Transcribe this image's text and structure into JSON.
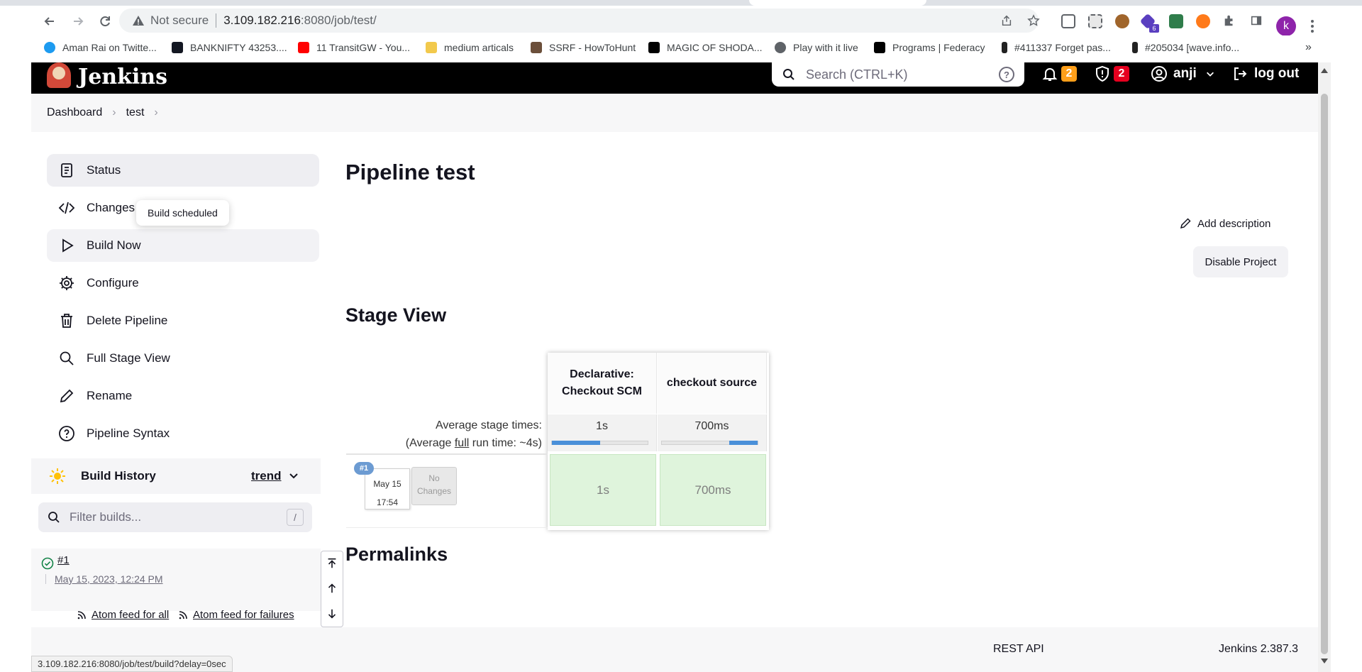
{
  "browser": {
    "security_label": "Not secure",
    "url_host": "3.109.182.216",
    "url_path": ":8080/job/test/",
    "profile_initial": "k",
    "ext_badge": "6",
    "bookmarks": [
      {
        "label": "Aman Rai on Twitte...",
        "color": "#1d9bf0"
      },
      {
        "label": "BANKNIFTY 43253....",
        "color": "#131722"
      },
      {
        "label": "11 TransitGW - You...",
        "color": "#ff0000"
      },
      {
        "label": "medium articals",
        "color": "#f2c94c"
      },
      {
        "label": "SSRF - HowToHunt",
        "color": "#6b4f3a"
      },
      {
        "label": "MAGIC OF SHODA...",
        "color": "#000000"
      },
      {
        "label": "Play with it live",
        "color": "#5f6368"
      },
      {
        "label": "Programs | Federacy",
        "color": "#000000"
      },
      {
        "label": "#411337 Forget pas...",
        "color": "#222222"
      },
      {
        "label": "#205034 [wave.info...",
        "color": "#222222"
      }
    ],
    "status_url": "3.109.182.216:8080/job/test/build?delay=0sec"
  },
  "header": {
    "brand": "Jenkins",
    "search_placeholder": "Search (CTRL+K)",
    "notifications_count": "2",
    "security_count": "2",
    "user": "anji",
    "logout": "log out"
  },
  "breadcrumb": [
    "Dashboard",
    "test"
  ],
  "sidebar": {
    "items": [
      {
        "label": "Status",
        "icon": "document-icon"
      },
      {
        "label": "Changes",
        "icon": "code-icon"
      },
      {
        "label": "Build Now",
        "icon": "play-icon"
      },
      {
        "label": "Configure",
        "icon": "gear-icon"
      },
      {
        "label": "Delete Pipeline",
        "icon": "trash-icon"
      },
      {
        "label": "Full Stage View",
        "icon": "search-icon"
      },
      {
        "label": "Rename",
        "icon": "pencil-icon"
      },
      {
        "label": "Pipeline Syntax",
        "icon": "help-icon"
      }
    ],
    "tooltip": "Build scheduled"
  },
  "build_history": {
    "title": "Build History",
    "trend": "trend",
    "filter_placeholder": "Filter builds...",
    "filter_shortcut": "/",
    "builds": [
      {
        "number": "#1",
        "date": "May 15, 2023, 12:24 PM",
        "status": "success"
      }
    ],
    "atom_all": "Atom feed for all",
    "atom_failures": "Atom feed for failures"
  },
  "main": {
    "title": "Pipeline test",
    "add_description": "Add description",
    "disable_project": "Disable Project",
    "stage_view_title": "Stage View",
    "permalinks_title": "Permalinks"
  },
  "stage_view": {
    "stages": [
      {
        "name": "Declarative: Checkout SCM",
        "avg": "1s",
        "avg_fraction": 0.5
      },
      {
        "name": "checkout source",
        "avg": "700ms",
        "avg_fraction": 0.3
      }
    ],
    "avg_stage_times_label": "Average stage times:",
    "avg_full_run_prefix": "(Average ",
    "avg_full_run_link": "full",
    "avg_full_run_suffix": " run time: ~4s)",
    "runs": [
      {
        "badge": "#1",
        "date_line1": "May 15",
        "date_line2": "17:54",
        "changes_line1": "No",
        "changes_line2": "Changes",
        "durations": [
          "1s",
          "700ms"
        ]
      }
    ]
  },
  "footer": {
    "rest_api": "REST API",
    "version": "Jenkins 2.387.3"
  },
  "colors": {
    "accent_orange": "#ff9f1a",
    "accent_red": "#e6001f",
    "success_green": "#138347",
    "stage_success_bg": "#dff4dc"
  }
}
